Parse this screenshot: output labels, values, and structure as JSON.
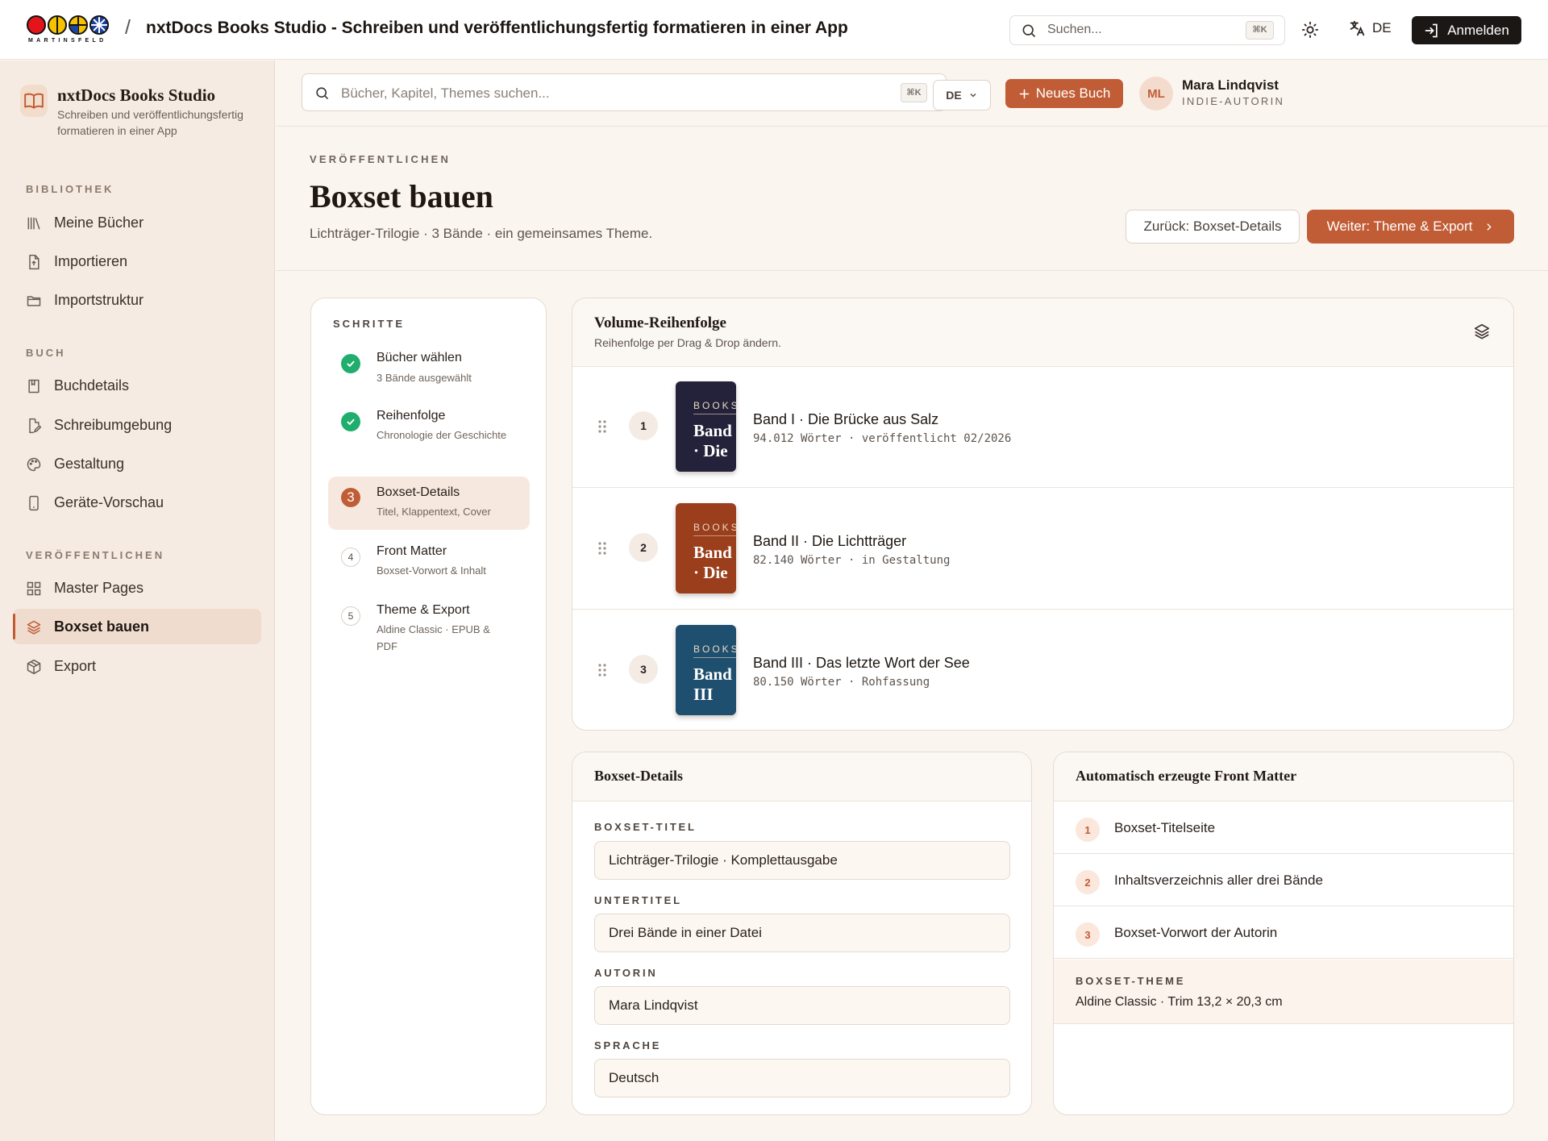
{
  "header": {
    "logo_text": "MARTINSFELD",
    "separator": "/",
    "app_title": "nxtDocs Books Studio - Schreiben und veröffentlichungsfertig formatieren in einer App",
    "search_placeholder": "Suchen...",
    "search_shortcut": "⌘K",
    "language": "DE",
    "login_label": "Anmelden"
  },
  "sidebar": {
    "brand_name": "nxtDocs Books Studio",
    "brand_subtitle": "Schreiben und veröffentlichungsfertig formatieren in einer App",
    "sections": [
      {
        "label": "BIBLIOTHEK",
        "items": [
          {
            "label": "Meine Bücher",
            "icon": "library-icon"
          },
          {
            "label": "Importieren",
            "icon": "file-import-icon"
          },
          {
            "label": "Importstruktur",
            "icon": "folder-icon"
          }
        ]
      },
      {
        "label": "BUCH",
        "items": [
          {
            "label": "Buchdetails",
            "icon": "book-icon"
          },
          {
            "label": "Schreibumgebung",
            "icon": "file-edit-icon"
          },
          {
            "label": "Gestaltung",
            "icon": "palette-icon"
          },
          {
            "label": "Geräte-Vorschau",
            "icon": "device-icon"
          }
        ]
      },
      {
        "label": "VERÖFFENTLICHEN",
        "items": [
          {
            "label": "Master Pages",
            "icon": "grid-icon"
          },
          {
            "label": "Boxset bauen",
            "icon": "layers-icon",
            "active": true
          },
          {
            "label": "Export",
            "icon": "package-icon"
          }
        ]
      }
    ]
  },
  "toolbar": {
    "search_placeholder": "Bücher, Kapitel, Themes suchen...",
    "search_shortcut": "⌘K",
    "language": "DE",
    "new_book_label": "Neues Buch",
    "user_initials": "ML",
    "user_name": "Mara Lindqvist",
    "user_role": "INDIE-AUTORIN"
  },
  "page": {
    "eyebrow": "VERÖFFENTLICHEN",
    "title": "Boxset bauen",
    "subtitle": "Lichträger-Trilogie · 3 Bände · ein gemeinsames Theme.",
    "back_label": "Zurück: Boxset-Details",
    "next_label": "Weiter: Theme & Export"
  },
  "steps": {
    "label": "SCHRITTE",
    "items": [
      {
        "number": "1",
        "title": "Bücher wählen",
        "subtitle": "3 Bände ausgewählt",
        "state": "done"
      },
      {
        "number": "2",
        "title": "Reihenfolge",
        "subtitle": "Chronologie der Geschichte",
        "state": "done"
      },
      {
        "number": "3",
        "title": "Boxset-Details",
        "subtitle": "Titel, Klappentext, Cover",
        "state": "current"
      },
      {
        "number": "4",
        "title": "Front Matter",
        "subtitle": "Boxset-Vorwort & Inhalt",
        "state": "todo"
      },
      {
        "number": "5",
        "title": "Theme & Export",
        "subtitle": "Aldine Classic · EPUB & PDF",
        "state": "todo"
      }
    ]
  },
  "volumes": {
    "title": "Volume-Reihenfolge",
    "subtitle": "Reihenfolge per Drag & Drop ändern.",
    "items": [
      {
        "position": "1",
        "cover_brand": "BOOKS",
        "cover_title": "Band I · Die",
        "title": "Band I · Die Brücke aus Salz",
        "meta": "94.012 Wörter · veröffentlicht 02/2026",
        "cover_color": "#24223a"
      },
      {
        "position": "2",
        "cover_brand": "BOOKS",
        "cover_title": "Band II · Die",
        "title": "Band II · Die Lichtträger",
        "meta": "82.140 Wörter · in Gestaltung",
        "cover_color": "#9a3e1c"
      },
      {
        "position": "3",
        "cover_brand": "BOOKS",
        "cover_title": "Band III",
        "title": "Band III · Das letzte Wort der See",
        "meta": "80.150 Wörter · Rohfassung",
        "cover_color": "#1f4f6e"
      }
    ]
  },
  "details": {
    "title": "Boxset-Details",
    "fields": [
      {
        "label": "BOXSET-TITEL",
        "value": "Lichträger-Trilogie · Komplettausgabe"
      },
      {
        "label": "UNTERTITEL",
        "value": "Drei Bände in einer Datei"
      },
      {
        "label": "AUTORIN",
        "value": "Mara Lindqvist"
      },
      {
        "label": "SPRACHE",
        "value": "Deutsch"
      }
    ]
  },
  "front_matter": {
    "title": "Automatisch erzeugte Front Matter",
    "items": [
      {
        "number": "1",
        "label": "Boxset-Titelseite"
      },
      {
        "number": "2",
        "label": "Inhaltsverzeichnis aller drei Bände"
      },
      {
        "number": "3",
        "label": "Boxset-Vorwort der Autorin"
      }
    ],
    "theme_label": "BOXSET-THEME",
    "theme_value": "Aldine Classic · Trim 13,2 × 20,3 cm"
  },
  "colors": {
    "accent": "#c15d36",
    "success": "#1fae6d",
    "sidebar_bg": "#f6ebe2",
    "page_bg": "#fbf5f0"
  }
}
